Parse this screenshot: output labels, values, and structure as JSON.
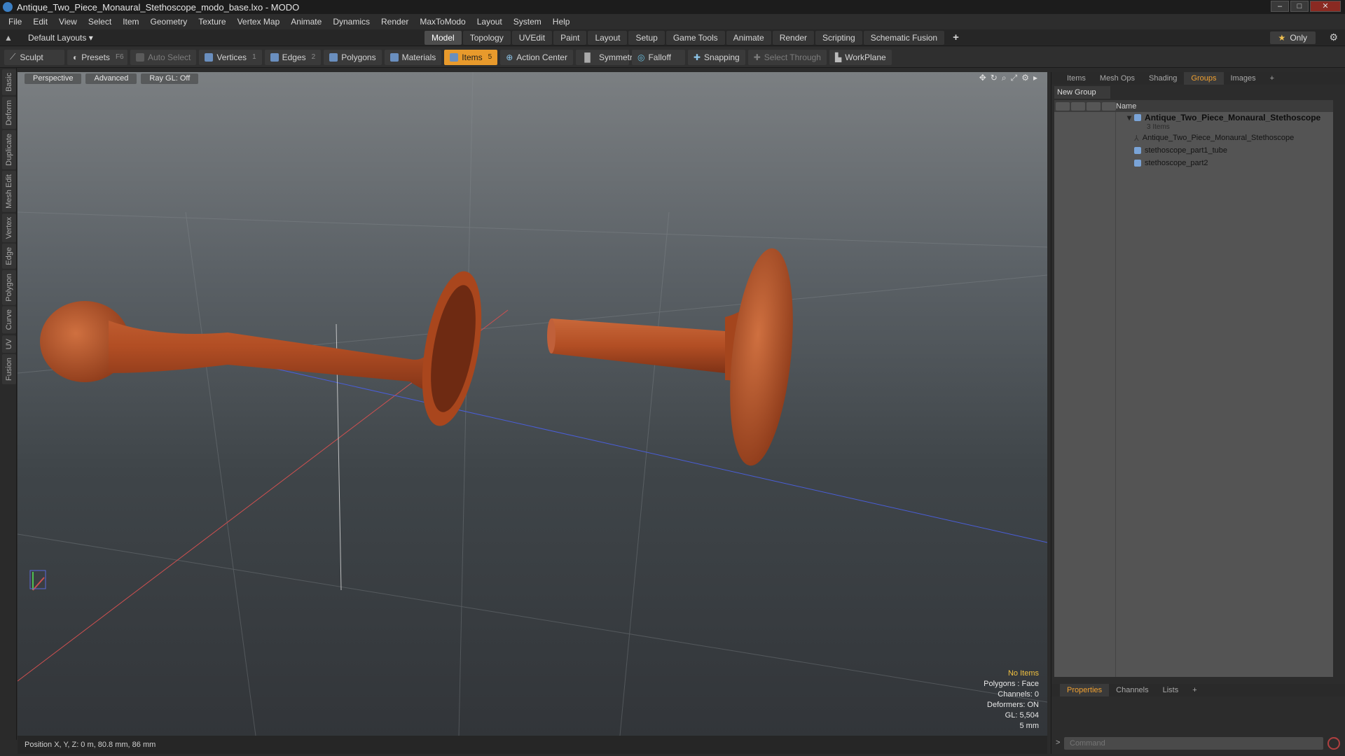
{
  "window": {
    "title": "Antique_Two_Piece_Monaural_Stethoscope_modo_base.lxo - MODO"
  },
  "menu": [
    "File",
    "Edit",
    "View",
    "Select",
    "Item",
    "Geometry",
    "Texture",
    "Vertex Map",
    "Animate",
    "Dynamics",
    "Render",
    "MaxToModo",
    "Layout",
    "System",
    "Help"
  ],
  "layouts": {
    "label": "Default Layouts"
  },
  "layout_tabs": [
    "Model",
    "Topology",
    "UVEdit",
    "Paint",
    "Layout",
    "Setup",
    "Game Tools",
    "Animate",
    "Render",
    "Scripting",
    "Schematic Fusion"
  ],
  "only_label": "Only",
  "toolbar": {
    "sculpt": "Sculpt",
    "presets": "Presets",
    "presets_key": "F6",
    "auto_select": "Auto Select",
    "vertices": "Vertices",
    "vertices_key": "1",
    "edges": "Edges",
    "edges_key": "2",
    "polygons": "Polygons",
    "materials": "Materials",
    "items": "Items",
    "items_key": "5",
    "action_center": "Action Center",
    "symmetry": "Symmetry",
    "falloff": "Falloff",
    "snapping": "Snapping",
    "select_through": "Select Through",
    "workplane": "WorkPlane"
  },
  "left_tabs": [
    "Basic",
    "Deform",
    "Duplicate",
    "Mesh Edit",
    "Vertex",
    "Edge",
    "Polygon",
    "Curve",
    "UV",
    "Fusion"
  ],
  "viewport": {
    "mode": "Perspective",
    "shading": "Advanced",
    "raygl": "Ray GL: Off",
    "stats": {
      "no_items": "No Items",
      "polygons": "Polygons : Face",
      "channels": "Channels: 0",
      "deformers": "Deformers: ON",
      "gl": "GL: 5,504",
      "unit": "5 mm"
    }
  },
  "status": {
    "position": "Position X, Y, Z:  0 m, 80.8 mm, 86 mm"
  },
  "right_panel": {
    "tabs": [
      "Items",
      "Mesh Ops",
      "Shading",
      "Groups",
      "Images"
    ],
    "new_group": "New Group",
    "name_header": "Name",
    "group_name": "Antique_Two_Piece_Monaural_Stethoscope",
    "group_count": "3 Items",
    "items": [
      "Antique_Two_Piece_Monaural_Stethoscope",
      "stethoscope_part1_tube",
      "stethoscope_part2"
    ]
  },
  "bottom_panel": {
    "tabs": [
      "Properties",
      "Channels",
      "Lists"
    ],
    "command_placeholder": "Command"
  },
  "colors": {
    "accent": "#f0a030",
    "wood": "#b5532a"
  }
}
